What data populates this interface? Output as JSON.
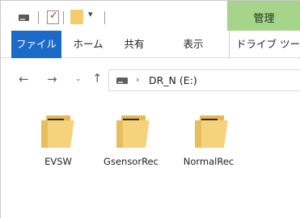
{
  "title_bar": {
    "quick_access_dropdown": "▾",
    "contextual_tab_label": "管理"
  },
  "ribbon": {
    "tabs": [
      {
        "label": "ファイル",
        "active": true
      },
      {
        "label": "ホーム"
      },
      {
        "label": "共有"
      },
      {
        "label": "表示"
      },
      {
        "label": "ドライブ ツール"
      }
    ]
  },
  "navigation": {
    "back": "←",
    "forward": "→",
    "recent": "⌄",
    "up": "↑",
    "breadcrumb_separator": "›",
    "address": "DR_N (E:)"
  },
  "files": [
    {
      "name": "EVSW",
      "type": "folder"
    },
    {
      "name": "GsensorRec",
      "type": "folder"
    },
    {
      "name": "NormalRec",
      "type": "folder"
    }
  ],
  "colors": {
    "file_tab": "#1b6ac9",
    "contextual_tab": "#a5d48a",
    "folder": "#f5d27c"
  }
}
